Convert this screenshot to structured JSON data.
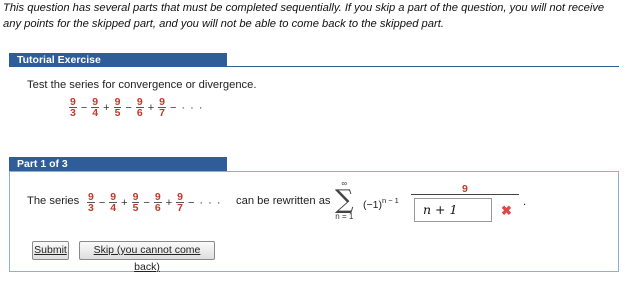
{
  "notice": "This question has several parts that must be completed sequentially. If you skip a part of the question, you will not receive any points for the skipped part, and you will not be able to come back to the skipped part.",
  "tutorial": {
    "title": "Tutorial Exercise",
    "instruction": "Test the series for convergence or divergence.",
    "series": {
      "terms": [
        {
          "num": "9",
          "den": "3"
        },
        {
          "num": "9",
          "den": "4"
        },
        {
          "num": "9",
          "den": "5"
        },
        {
          "num": "9",
          "den": "6"
        },
        {
          "num": "9",
          "den": "7"
        }
      ],
      "ops": [
        "−",
        "+",
        "−",
        "+",
        "−"
      ],
      "ellipsis": "· · ·"
    }
  },
  "part": {
    "title": "Part 1 of 3",
    "lead": "The series",
    "rewrite": "can be rewritten as",
    "sigma": {
      "symbol": "∑",
      "upper": "∞",
      "lower": "n = 1"
    },
    "power_base": "(−1)",
    "power_exp": "n − 1",
    "answer_numerator": "9",
    "answer_input": "n + 1",
    "answer_status": "incorrect",
    "period": ".",
    "status_icon": "x-icon",
    "status_color": "#e04848"
  },
  "buttons": {
    "submit": "Submit",
    "skip": "Skip (you cannot come back)"
  },
  "colors": {
    "accent": "#2e5d9a",
    "fraction": "#c0392b"
  }
}
